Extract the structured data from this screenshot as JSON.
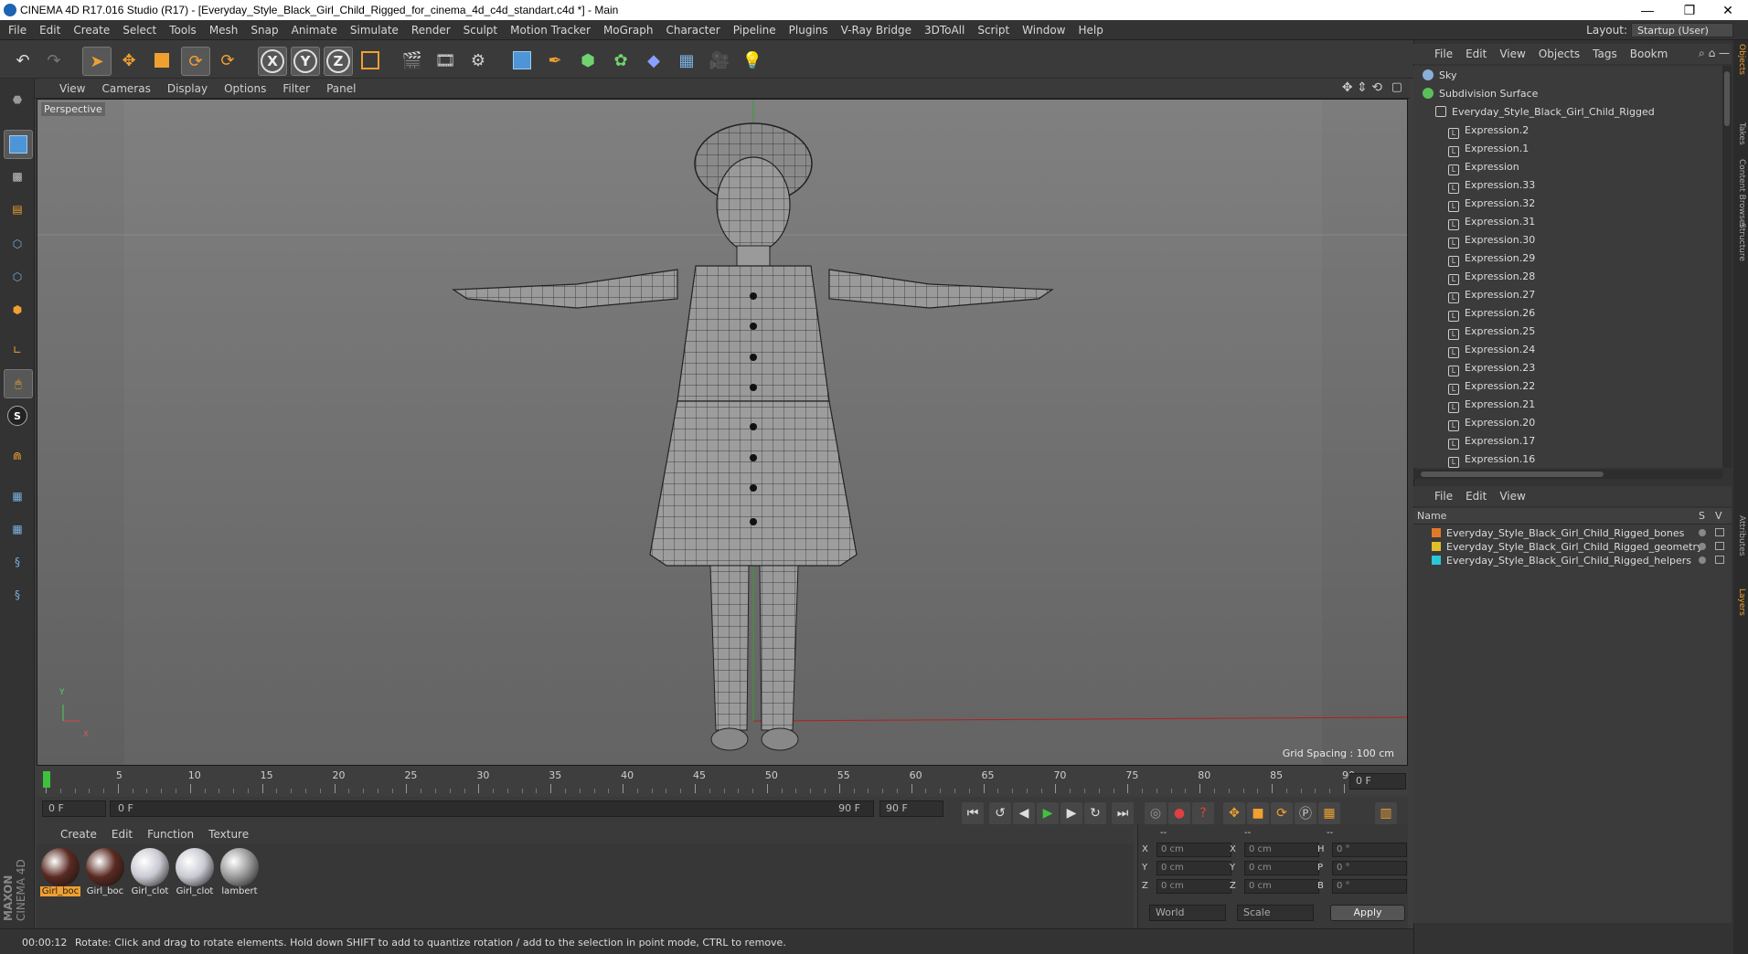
{
  "window": {
    "title": "CINEMA 4D R17.016 Studio (R17) - [Everyday_Style_Black_Girl_Child_Rigged_for_cinema_4d_c4d_standart.c4d *] - Main",
    "minimize": "—",
    "restore": "❐",
    "close": "✕"
  },
  "menubar": {
    "items": [
      "File",
      "Edit",
      "Create",
      "Select",
      "Tools",
      "Mesh",
      "Snap",
      "Animate",
      "Simulate",
      "Render",
      "Sculpt",
      "Motion Tracker",
      "MoGraph",
      "Character",
      "Pipeline",
      "Plugins",
      "V-Ray Bridge",
      "3DToAll",
      "Script",
      "Window",
      "Help"
    ],
    "layout_label": "Layout:",
    "layout_value": "Startup (User)"
  },
  "toolbar": {
    "axis_x": "X",
    "axis_y": "Y",
    "axis_z": "Z"
  },
  "viewport": {
    "menu": [
      "View",
      "Cameras",
      "Display",
      "Options",
      "Filter",
      "Panel"
    ],
    "label": "Perspective",
    "grid_spacing": "Grid Spacing : 100 cm",
    "axis_y_label": "Y",
    "axis_x_label": "X"
  },
  "timeline": {
    "ticks": [
      "0",
      "5",
      "10",
      "15",
      "20",
      "25",
      "30",
      "35",
      "40",
      "45",
      "50",
      "55",
      "60",
      "65",
      "70",
      "75",
      "80",
      "85",
      "90"
    ],
    "current_frame_field": "0 F",
    "start_field": "0 F",
    "range_start": "0 F",
    "range_end": "90 F",
    "end_field": "90 F"
  },
  "materials": {
    "menu": [
      "Create",
      "Edit",
      "Function",
      "Texture"
    ],
    "items": [
      {
        "label": "Girl_boc",
        "color": "#5a2a22",
        "selected": true
      },
      {
        "label": "Girl_boc",
        "color": "#5a2a22",
        "selected": false
      },
      {
        "label": "Girl_clot",
        "color": "#c9c9d2",
        "selected": false
      },
      {
        "label": "Girl_clot",
        "color": "#c9c9d2",
        "selected": false
      },
      {
        "label": "lambert",
        "color": "#9a9a9a",
        "selected": false
      }
    ]
  },
  "coordinates": {
    "header": [
      "--",
      "--",
      "--"
    ],
    "rows": [
      {
        "a": "X",
        "av": "0 cm",
        "b": "X",
        "bv": "0 cm",
        "c": "H",
        "cv": "0 °"
      },
      {
        "a": "Y",
        "av": "0 cm",
        "b": "Y",
        "bv": "0 cm",
        "c": "P",
        "cv": "0 °"
      },
      {
        "a": "Z",
        "av": "0 cm",
        "b": "Z",
        "bv": "0 cm",
        "c": "B",
        "cv": "0 °"
      }
    ],
    "mode": "World",
    "type": "Scale",
    "apply": "Apply"
  },
  "status": {
    "time": "00:00:12",
    "message": "Rotate: Click and drag to rotate elements. Hold down SHIFT to add to quantize rotation / add to the selection in point mode, CTRL to remove."
  },
  "objects": {
    "menu": [
      "File",
      "Edit",
      "View",
      "Objects",
      "Tags",
      "Bookm"
    ],
    "top": [
      {
        "label": "Sky",
        "indent": 0
      },
      {
        "label": "Subdivision Surface",
        "indent": 0
      },
      {
        "label": "Everyday_Style_Black_Girl_Child_Rigged",
        "indent": 1
      }
    ],
    "expressions": [
      "Expression.2",
      "Expression.1",
      "Expression",
      "Expression.33",
      "Expression.32",
      "Expression.31",
      "Expression.30",
      "Expression.29",
      "Expression.28",
      "Expression.27",
      "Expression.26",
      "Expression.25",
      "Expression.24",
      "Expression.23",
      "Expression.22",
      "Expression.21",
      "Expression.20",
      "Expression.17",
      "Expression.16"
    ]
  },
  "layers": {
    "menu": [
      "File",
      "Edit",
      "View"
    ],
    "col_name": "Name",
    "col_s": "S",
    "col_v": "V",
    "items": [
      {
        "label": "Everyday_Style_Black_Girl_Child_Rigged_bones",
        "color": "#e07a2a"
      },
      {
        "label": "Everyday_Style_Black_Girl_Child_Rigged_geometry",
        "color": "#e0c02a"
      },
      {
        "label": "Everyday_Style_Black_Girl_Child_Rigged_helpers",
        "color": "#2ac8d8"
      }
    ]
  },
  "side_tabs": [
    "Objects",
    "Takes",
    "Content Browser",
    "Structure",
    "Attributes",
    "Layers"
  ],
  "branding": {
    "vendor": "MAXON",
    "product": "CINEMA 4D"
  }
}
